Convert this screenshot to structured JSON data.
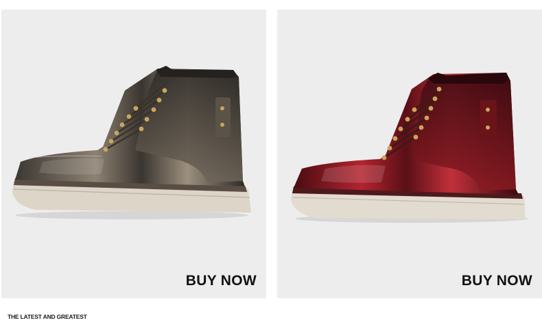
{
  "products": [
    {
      "name": "Dark brushed leather lace-up boot",
      "cta_label": "BUY NOW",
      "colors": {
        "leather_dark": "#2b2825",
        "leather_light": "#a79a87",
        "sole": "#ddd5c8",
        "welt": "#5a4d44"
      }
    },
    {
      "name": "Burgundy polished leather lace-up boot",
      "cta_label": "BUY NOW",
      "colors": {
        "leather_dark": "#3a0a10",
        "leather_light": "#b2242f",
        "sole": "#e2dbd0",
        "welt": "#4d1a1c"
      }
    }
  ],
  "footer": {
    "tagline": "THE LATEST AND GREATEST"
  },
  "colors": {
    "card_bg": "#ededed",
    "page_bg": "#ffffff",
    "text": "#111111"
  }
}
